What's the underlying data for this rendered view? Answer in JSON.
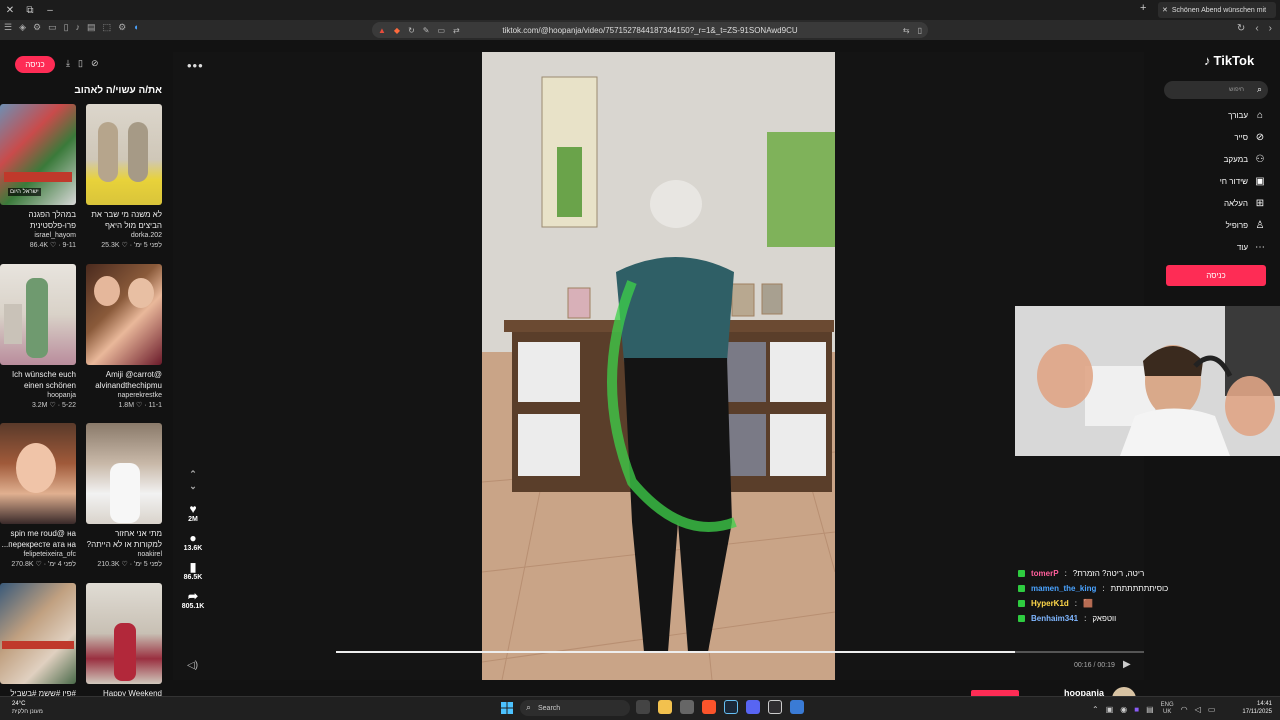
{
  "browser": {
    "tab_title": "Schönen Abend wünschen mit",
    "url": "tiktok.com/@hoopanja/video/7571527844187344150?_r=1&_t=ZS-91SONAwd9CU"
  },
  "left_panel": {
    "login_label": "כניסה",
    "heading": "את/ה עשוי/ה לאהוב",
    "cards": [
      {
        "title": "במהלך הפגנה פרו-פלסטינית בבריטניה,...",
        "author": "israel_hayom",
        "likes": "86.4K",
        "date": "9-11"
      },
      {
        "title": "לא משנה מי שבר את הביצים מול היאף של...",
        "author": "dorka.202",
        "likes": "25.3K",
        "date": "לפני 5 ימ'"
      },
      {
        "title": "Ich wünsche euch einen schönen",
        "author": "hoopanja",
        "likes": "3.2M",
        "date": "5-22"
      },
      {
        "title": "Amiji @carrot@ alvinandthechipmu",
        "author": "naperekrestke",
        "likes": "1.8M",
        "date": "11-1"
      },
      {
        "title": "spin me roud@ на перекресте ата на...",
        "author": "felipeteixeira_ofc",
        "likes": "270.8K",
        "date": "לפני 4 ימ'"
      },
      {
        "title": "מתי אני אחזור למקורות או לא הייתה?",
        "author": "noakirel",
        "likes": "210.3K",
        "date": "לפני 5 ימ'"
      },
      {
        "title": "#פיו #ששמ #בשביל",
        "author": "",
        "likes": "",
        "date": ""
      },
      {
        "title": "Happy Weekend",
        "author": "",
        "likes": "",
        "date": ""
      }
    ]
  },
  "video_actions": {
    "likes": "2M",
    "comments": "13.6K",
    "saves": "86.5K",
    "shares": "805.1K"
  },
  "player": {
    "time": "00:16 / 00:19",
    "progress": 0.84
  },
  "sidebar": {
    "logo": "TikTok",
    "search_placeholder": "חיפוש",
    "nav": [
      {
        "label": "עבורך"
      },
      {
        "label": "סייר"
      },
      {
        "label": "במעקב"
      },
      {
        "label": "שידור חי"
      },
      {
        "label": "העלאה"
      },
      {
        "label": "פרופיל"
      },
      {
        "label": "עוד"
      }
    ],
    "login_label": "כניסה"
  },
  "chat": [
    {
      "user": "tomerP",
      "color": "#ff5f9b",
      "text": "?ריטה, ריטה? הזמרת"
    },
    {
      "user": "mamen_the_king",
      "color": "#4aa3ff",
      "text": "כוסיתתתתתתתת"
    },
    {
      "user": "HyperK1d",
      "color": "#ffd84a",
      "text": "🟫"
    },
    {
      "user": "Benhaim341",
      "color": "#7fb6ff",
      "text": "ווטפאק"
    }
  ],
  "bottom": {
    "username": "hoopanja"
  },
  "taskbar": {
    "temp": "24°C",
    "weather_desc": "מעונן חלקית",
    "search_placeholder": "Search",
    "lang_top": "ENG",
    "lang_bottom": "UK",
    "time": "14:41",
    "date": "17/11/2025"
  },
  "icons": [
    "close-icon",
    "gear-icon",
    "search-icon",
    "home-icon",
    "compass-icon",
    "following-icon",
    "live-icon",
    "upload-icon",
    "profile-icon",
    "more-icon",
    "heart-icon",
    "comment-icon",
    "bookmark-icon",
    "share-icon",
    "volume-icon",
    "play-icon",
    "chevron-up-icon",
    "chevron-down-icon"
  ],
  "colors": {
    "accent": "#fe2c55",
    "badge": "#2ecc40"
  }
}
